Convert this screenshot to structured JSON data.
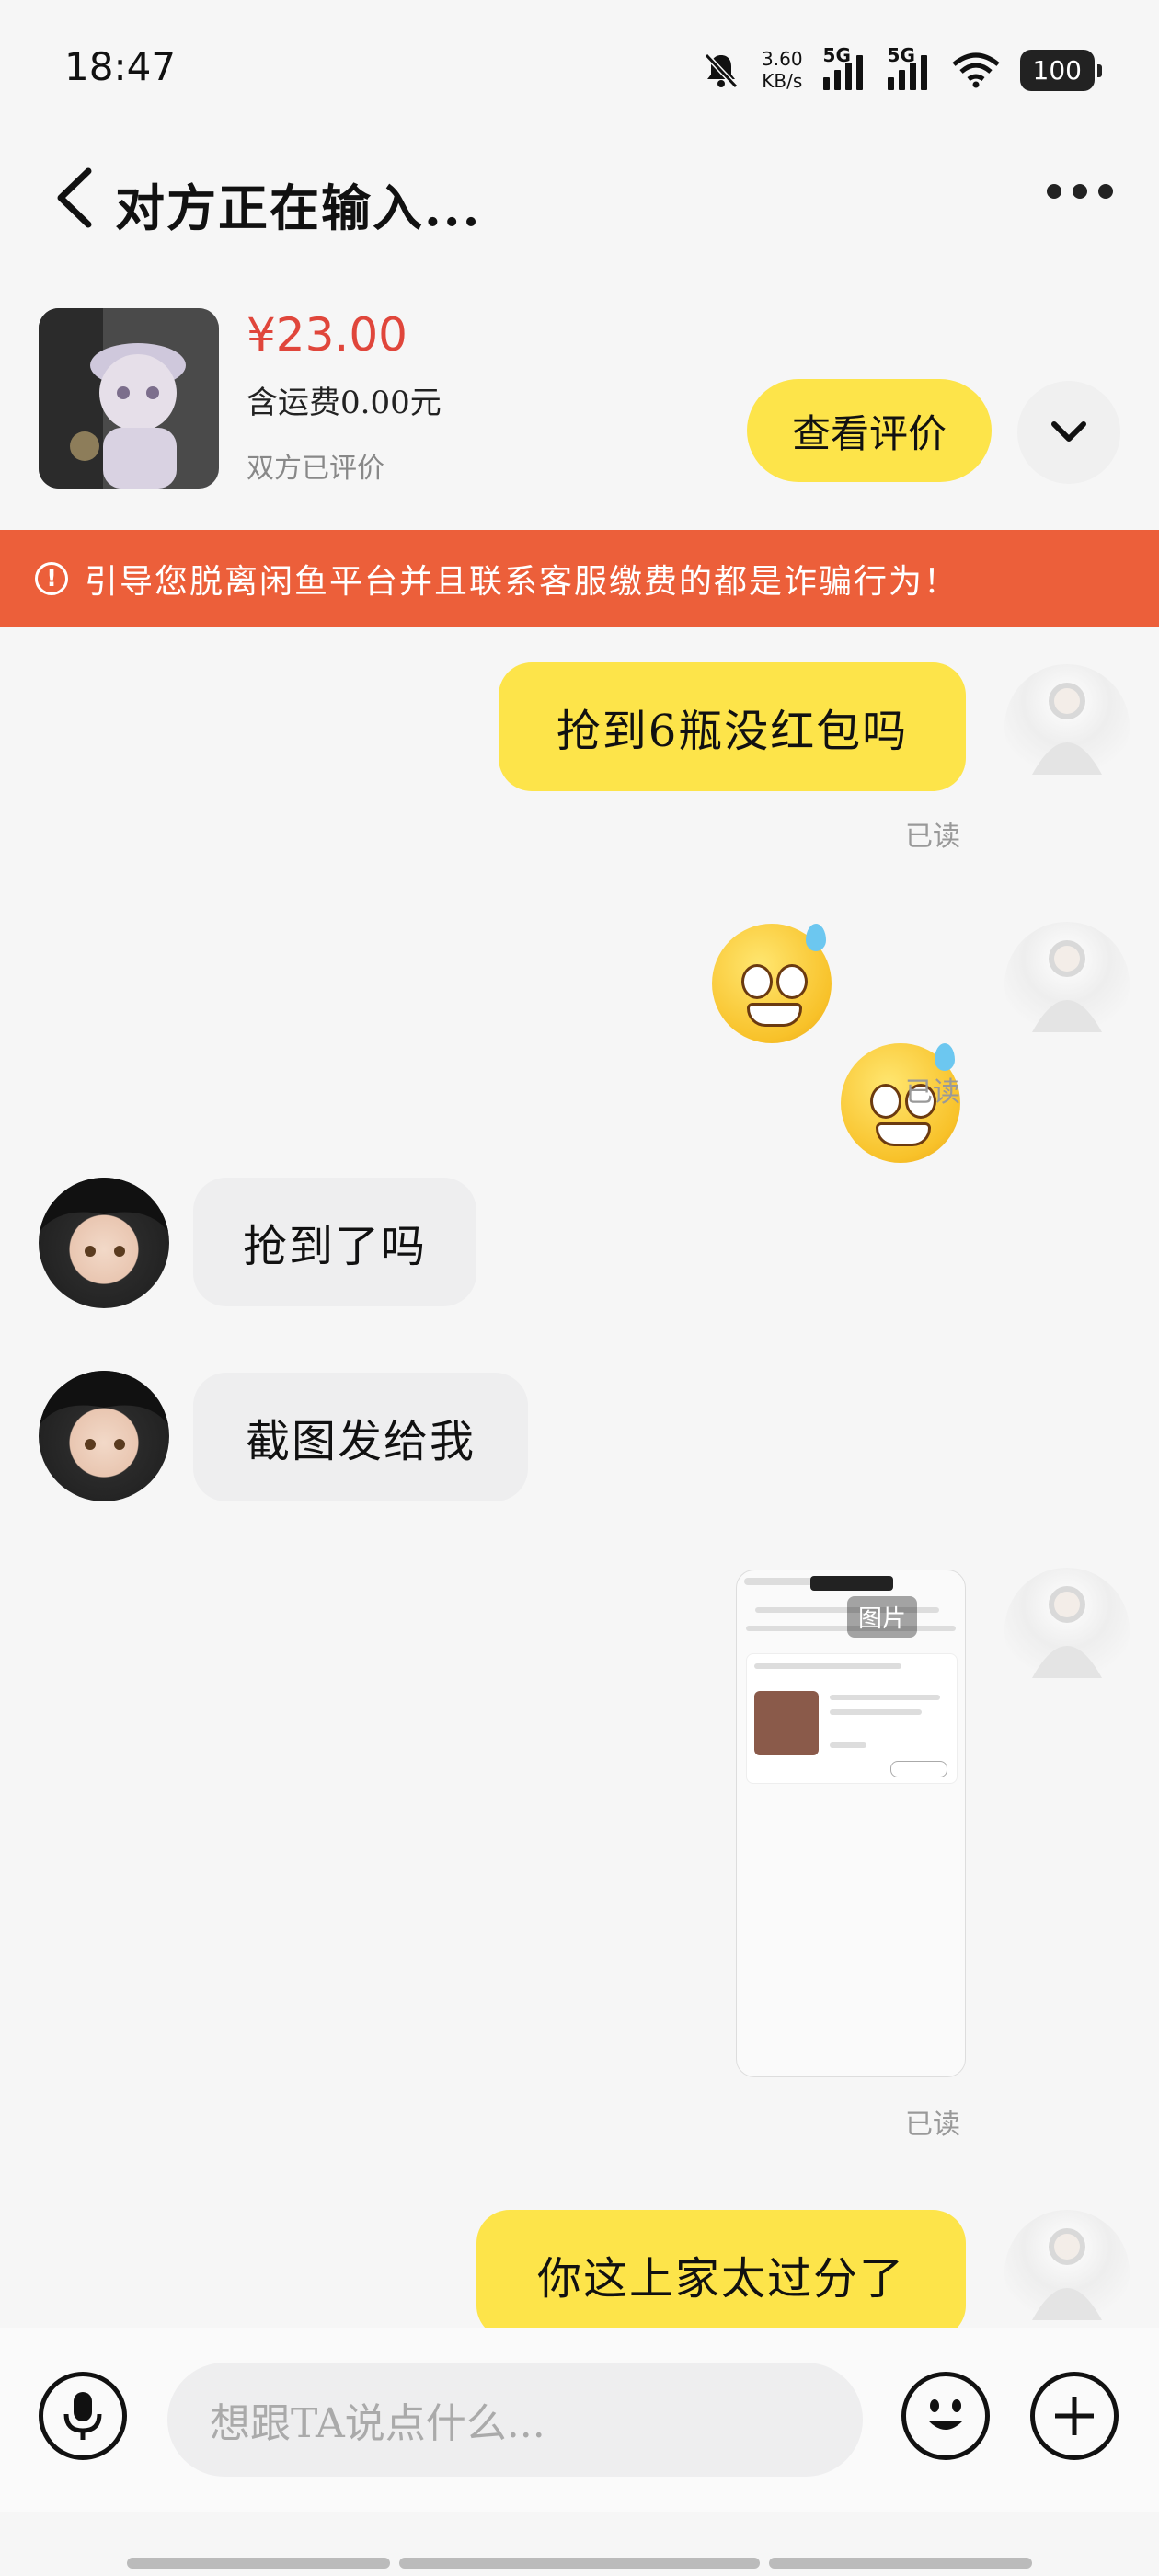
{
  "status_bar": {
    "time": "18:47",
    "speed_value": "3.60",
    "speed_unit": "KB/s",
    "sim1": "5G",
    "sim2": "5G",
    "battery": "100",
    "icons": [
      "mute-bell-icon",
      "signal-icon",
      "wifi-icon",
      "battery-icon"
    ]
  },
  "header": {
    "title": "对方正在输入...",
    "icons": [
      "back-chevron-icon",
      "more-dots-icon"
    ]
  },
  "product": {
    "price": "¥23.00",
    "shipping": "含运费0.00元",
    "rating_status": "双方已评价",
    "review_button": "查看评价"
  },
  "warning": {
    "text": "引导您脱离闲鱼平台并且联系客服缴费的都是诈骗行为！"
  },
  "messages": {
    "m1": {
      "text": "抢到6瓶没红包吗",
      "status": "已读"
    },
    "m2": {
      "status": "已读"
    },
    "m3": {
      "text": "抢到了吗"
    },
    "m4": {
      "text": "截图发给我"
    },
    "m5": {
      "tag": "图片",
      "status": "已读"
    },
    "m6": {
      "text": "你这上家太过分了"
    }
  },
  "input": {
    "placeholder": "想跟TA说点什么..."
  },
  "colors": {
    "accent_yellow": "#fde44a",
    "warning_orange": "#ec5f3a",
    "price_red": "#e0463b"
  }
}
